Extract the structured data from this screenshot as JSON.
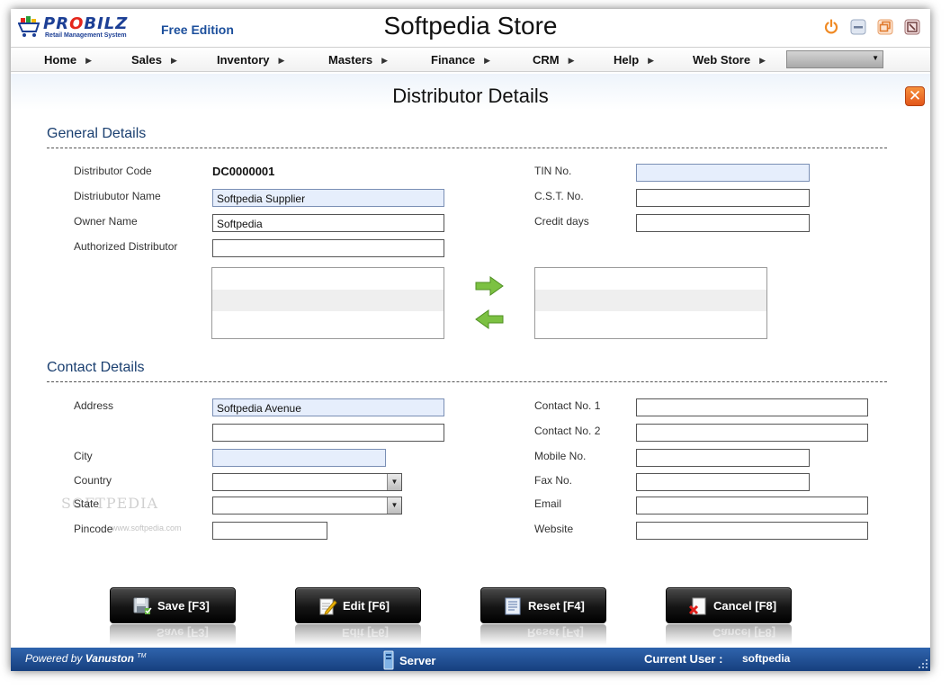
{
  "app": {
    "logo_text_pre": "PR",
    "logo_text_o": "O",
    "logo_text_post": "BILZ",
    "logo_subtitle": "Retail Management System",
    "edition": "Free Edition",
    "title": "Softpedia Store"
  },
  "window_controls": [
    "power-icon",
    "minimize-icon",
    "restore-icon",
    "close-icon"
  ],
  "menu": {
    "items": [
      {
        "label": "Home"
      },
      {
        "label": "Sales"
      },
      {
        "label": "Inventory"
      },
      {
        "label": "Masters"
      },
      {
        "label": "Finance"
      },
      {
        "label": "CRM"
      },
      {
        "label": "Help"
      },
      {
        "label": "Web Store"
      }
    ],
    "select_value": ""
  },
  "page": {
    "title": "Distributor Details",
    "close_label": "✕"
  },
  "general": {
    "section_title": "General Details",
    "distributor_code_label": "Distributor Code",
    "distributor_code_value": "DC0000001",
    "distributor_name_label": "Distriubutor Name",
    "distributor_name_value": "Softpedia Supplier",
    "owner_name_label": "Owner Name",
    "owner_name_value": "Softpedia",
    "authorized_label": "Authorized Distributor",
    "authorized_value": "",
    "tin_label": "TIN No.",
    "tin_value": "",
    "cst_label": "C.S.T. No.",
    "cst_value": "",
    "credit_label": "Credit days",
    "credit_value": ""
  },
  "contact": {
    "section_title": "Contact Details",
    "address_label": "Address",
    "address_line1": "Softpedia Avenue",
    "address_line2": "",
    "city_label": "City",
    "city_value": "",
    "country_label": "Country",
    "country_value": "",
    "state_label": "State",
    "state_value": "",
    "pincode_label": "Pincode",
    "pincode_value": "",
    "contact1_label": "Contact No. 1",
    "contact1_value": "",
    "contact2_label": "Contact No. 2",
    "contact2_value": "",
    "mobile_label": "Mobile No.",
    "mobile_value": "",
    "fax_label": "Fax No.",
    "fax_value": "",
    "email_label": "Email",
    "email_value": "",
    "website_label": "Website",
    "website_value": ""
  },
  "watermark": {
    "brand": "SOFTPEDIA",
    "url": "www.softpedia.com"
  },
  "actions": {
    "save": "Save [F3]",
    "edit": "Edit [F6]",
    "reset": "Reset [F4]",
    "cancel": "Cancel [F8]"
  },
  "status": {
    "powered_prefix": "Powered by",
    "powered_brand": "Vanuston",
    "powered_tm": "TM",
    "server": "Server",
    "current_user_label": "Current User :",
    "current_user_value": "softpedia"
  },
  "colors": {
    "accent_blue": "#1c4f9c",
    "section_title": "#1a3f70",
    "required_field": "#e6eefc",
    "status_bar": "#2f64ad",
    "close_orange": "#e2561a"
  }
}
